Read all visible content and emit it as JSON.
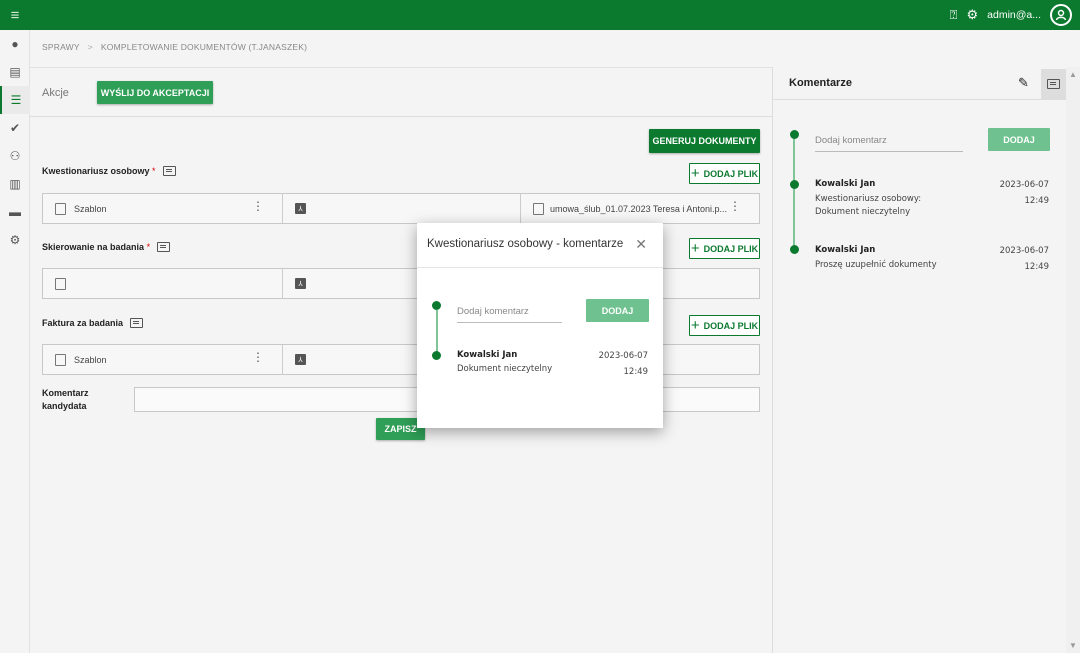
{
  "topbar": {
    "user": "admin@a..."
  },
  "breadcrumb": {
    "root": "SPRAWY",
    "separator": ">",
    "current": "KOMPLETOWANIE DOKUMENTÓW (T.JANASZEK)"
  },
  "actions": {
    "label": "Akcje",
    "send_button": "WYŚLIJ DO AKCEPTACJI",
    "generate_button": "GENERUJ DOKUMENTY"
  },
  "sections": [
    {
      "label": "Kwestionariusz osobowy",
      "required": "*",
      "add_button": "DODAJ PLIK",
      "template": "Szablon",
      "file": "umowa_ślub_01.07.2023 Teresa i Antoni.p..."
    },
    {
      "label": "Skierowanie na badania",
      "required": "*",
      "add_button": "DODAJ PLIK",
      "template": "",
      "file": ""
    },
    {
      "label": "Faktura za badania",
      "required": "",
      "add_button": "DODAJ PLIK",
      "template": "Szablon",
      "file": ""
    }
  ],
  "candidate_comment": {
    "label_line1": "Komentarz",
    "label_line2": "kandydata"
  },
  "save_button": "ZAPISZ",
  "comments_panel": {
    "title": "Komentarze",
    "input_placeholder": "Dodaj komentarz",
    "add_button": "DODAJ",
    "comments": [
      {
        "author": "Kowalski Jan",
        "text_line1": "Kwestionariusz osobowy:",
        "text_line2": "Dokument nieczytelny",
        "date": "2023-06-07",
        "time": "12:49"
      },
      {
        "author": "Kowalski Jan",
        "text_line1": "Proszę uzupełnić dokumenty",
        "text_line2": "",
        "date": "2023-06-07",
        "time": "12:49"
      }
    ]
  },
  "modal": {
    "title": "Kwestionariusz osobowy - komentarze",
    "input_placeholder": "Dodaj komentarz",
    "add_button": "DODAJ",
    "comment": {
      "author": "Kowalski Jan",
      "text": "Dokument nieczytelny",
      "date": "2023-06-07",
      "time": "12:49"
    }
  },
  "colors": {
    "primary": "#0b7a2f",
    "button_green": "#2f9e56",
    "button_light": "#6fc28f"
  }
}
